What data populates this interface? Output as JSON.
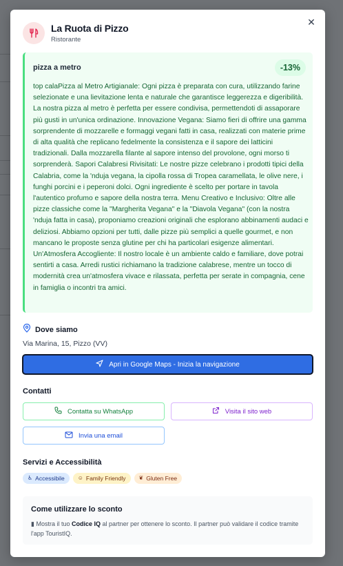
{
  "modal": {
    "close_icon": "close-icon",
    "business": {
      "name": "La Ruota di Pizzo",
      "category": "Ristorante",
      "icon": "utensils-icon",
      "icon_bg": "#fbe4e4",
      "icon_color": "#e11d48"
    },
    "offer": {
      "name": "pizza a metro",
      "discount": "-13%",
      "description": "top calaPizza al Metro Artigianale: Ogni pizza è preparata con cura, utilizzando farine selezionate e una lievitazione lenta e naturale che garantisce leggerezza e digeribilità. La nostra pizza al metro è perfetta per essere condivisa, permettendoti di assaporare più gusti in un'unica ordinazione. Innovazione Vegana: Siamo fieri di offrire una gamma sorprendente di mozzarelle e formaggi vegani fatti in casa, realizzati con materie prime di alta qualità che replicano fedelmente la consistenza e il sapore dei latticini tradizionali. Dalla mozzarella filante al sapore intenso del provolone, ogni morso ti sorprenderà. Sapori Calabresi Rivisitati: Le nostre pizze celebrano i prodotti tipici della Calabria, come la 'nduja vegana, la cipolla rossa di Tropea caramellata, le olive nere, i funghi porcini e i peperoni dolci. Ogni ingrediente è scelto per portare in tavola l'autentico profumo e sapore della nostra terra. Menu Creativo e Inclusivo: Oltre alle pizze classiche come la \"Margherita Vegana\" e la \"Diavola Vegana\" (con la nostra 'nduja fatta in casa), proponiamo creazioni originali che esplorano abbinamenti audaci e deliziosi. Abbiamo opzioni per tutti, dalle pizze più semplici a quelle gourmet, e non mancano le proposte senza glutine per chi ha particolari esigenze alimentari. Un'Atmosfera Accogliente: Il nostro locale è un ambiente caldo e familiare, dove potrai sentirti a casa. Arredi rustici richiamano la tradizione calabrese, mentre un tocco di modernità crea un'atmosfera vivace e rilassata, perfetta per serate in compagnia, cene in famiglia o incontri tra amici."
    },
    "location": {
      "heading": "Dove siamo",
      "icon": "map-pin-icon",
      "address": "Via Marina, 15, Pizzo (VV)",
      "maps_button": "Apri in Google Maps - Inizia la navigazione",
      "maps_icon": "navigation-icon"
    },
    "contacts": {
      "heading": "Contatti",
      "whatsapp": "Contatta su WhatsApp",
      "website": "Visita il sito web",
      "email": "Invia una email"
    },
    "services": {
      "heading": "Servizi e Accessibilità",
      "badges": [
        {
          "label": "Accessibile",
          "icon": "accessibility-icon"
        },
        {
          "label": "Family Friendly",
          "icon": "child-icon"
        },
        {
          "label": "Gluten Free",
          "icon": "wheat-icon"
        }
      ]
    },
    "howto": {
      "title": "Come utilizzare lo sconto",
      "icon": "phone-icon",
      "text_before": "Mostra il tuo",
      "code_label": "Codice IQ",
      "text_after": "al partner per ottenere lo sconto. Il partner può validare il codice tramite l'app TouristIQ."
    }
  },
  "colors": {
    "primary": "#2f6de3",
    "offer_bg": "#f0fdf4",
    "offer_accent": "#4ade80",
    "offer_text": "#166534"
  }
}
